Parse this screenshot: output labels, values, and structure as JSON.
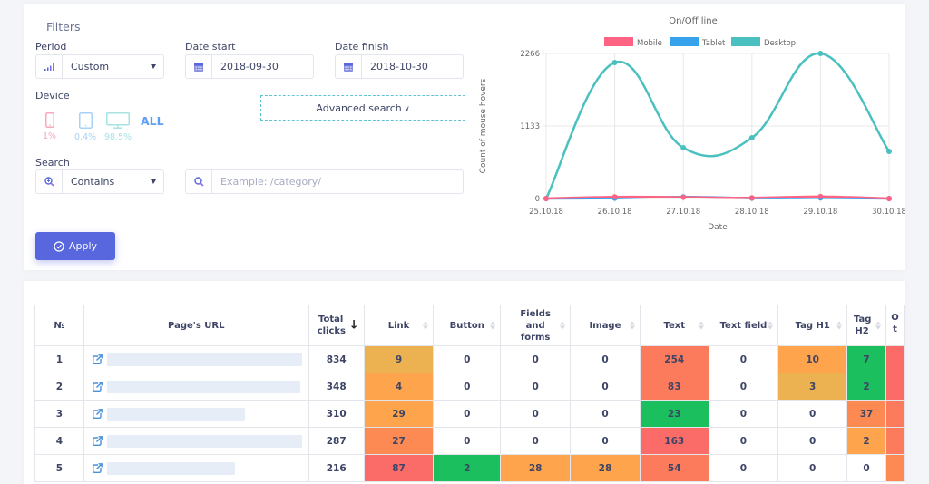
{
  "filters": {
    "title": "Filters",
    "period": {
      "label": "Period",
      "icon": "signal-bars-icon",
      "value": "Custom"
    },
    "date_start": {
      "label": "Date start",
      "icon": "calendar-icon",
      "value": "2018-09-30"
    },
    "date_finish": {
      "label": "Date finish",
      "icon": "calendar-icon",
      "value": "2018-10-30"
    },
    "device": {
      "label": "Device",
      "items": [
        {
          "name": "mobile",
          "icon": "mobile-icon",
          "percent": "1%",
          "color": "#f7a8b8"
        },
        {
          "name": "tablet",
          "icon": "tablet-icon",
          "percent": "0.4%",
          "color": "#a9d1f7"
        },
        {
          "name": "desktop",
          "icon": "desktop-icon",
          "percent": "98.5%",
          "color": "#a8e3e3"
        }
      ],
      "all_label": "ALL"
    },
    "advanced_search_label": "Advanced search",
    "search": {
      "label": "Search",
      "mode_icon": "zoom-in-icon",
      "mode": "Contains",
      "input_icon": "search-icon",
      "placeholder": "Example: /category/"
    },
    "apply_label": "Apply",
    "accent": "#5867dd"
  },
  "chart_data": {
    "type": "line",
    "title": "On/Off line",
    "xlabel": "Date",
    "ylabel": "Count of mouse hovers",
    "x": [
      "25.10.18",
      "26.10.18",
      "27.10.18",
      "28.10.18",
      "29.10.18",
      "30.10.18"
    ],
    "yticks": [
      0,
      1133,
      2266
    ],
    "ylim": [
      0,
      2266
    ],
    "grid": true,
    "legend_position": "top",
    "series": [
      {
        "name": "Mobile",
        "color": "#ff6384",
        "values": [
          0,
          25,
          20,
          10,
          30,
          0
        ]
      },
      {
        "name": "Tablet",
        "color": "#36a2eb",
        "values": [
          0,
          5,
          25,
          5,
          10,
          0
        ]
      },
      {
        "name": "Desktop",
        "color": "#4bc0c0",
        "values": [
          0,
          2124,
          793,
          949,
          2266,
          736
        ]
      }
    ]
  },
  "table": {
    "columns": [
      "№",
      "Page's URL",
      "Total clicks",
      "Link",
      "Button",
      "Fields and forms",
      "Image",
      "Text",
      "Text field",
      "Tag H1",
      "Tag H2",
      "O t"
    ],
    "rows": [
      {
        "n": "1",
        "url_redacted": true,
        "total": "834",
        "cells": [
          "9",
          "0",
          "0",
          "0",
          "254",
          "0",
          "10",
          "7",
          ""
        ],
        "colors": [
          "#ecb252",
          "",
          "",
          "",
          "#fd7b5d",
          "",
          "#fda44c",
          "#1bbf5e",
          "#fb6b68"
        ]
      },
      {
        "n": "2",
        "url_redacted": true,
        "total": "348",
        "cells": [
          "4",
          "0",
          "0",
          "0",
          "83",
          "0",
          "3",
          "2",
          ""
        ],
        "colors": [
          "#fda44c",
          "",
          "",
          "",
          "#fd7b5d",
          "",
          "#ecb252",
          "#1bbf5e",
          "#fb6b68"
        ]
      },
      {
        "n": "3",
        "url_redacted": true,
        "total": "310",
        "cells": [
          "29",
          "0",
          "0",
          "0",
          "23",
          "0",
          "0",
          "37",
          ""
        ],
        "colors": [
          "#fda44c",
          "",
          "",
          "",
          "#1bbf5e",
          "",
          "",
          "#fd8a52",
          "#fd7b5d"
        ]
      },
      {
        "n": "4",
        "url_redacted": true,
        "total": "287",
        "cells": [
          "27",
          "0",
          "0",
          "0",
          "163",
          "0",
          "0",
          "2",
          ""
        ],
        "colors": [
          "#fd8a52",
          "",
          "",
          "",
          "#fb6b68",
          "",
          "",
          "#fda44c",
          "#fd7b5d"
        ]
      },
      {
        "n": "5",
        "url_redacted": true,
        "total": "216",
        "cells": [
          "87",
          "2",
          "28",
          "28",
          "54",
          "0",
          "0",
          "0",
          ""
        ],
        "colors": [
          "#fb6b68",
          "#1bbf5e",
          "#fda44c",
          "#fda44c",
          "#fd7b5d",
          "",
          "",
          "",
          "#fd8a52"
        ]
      }
    ]
  }
}
